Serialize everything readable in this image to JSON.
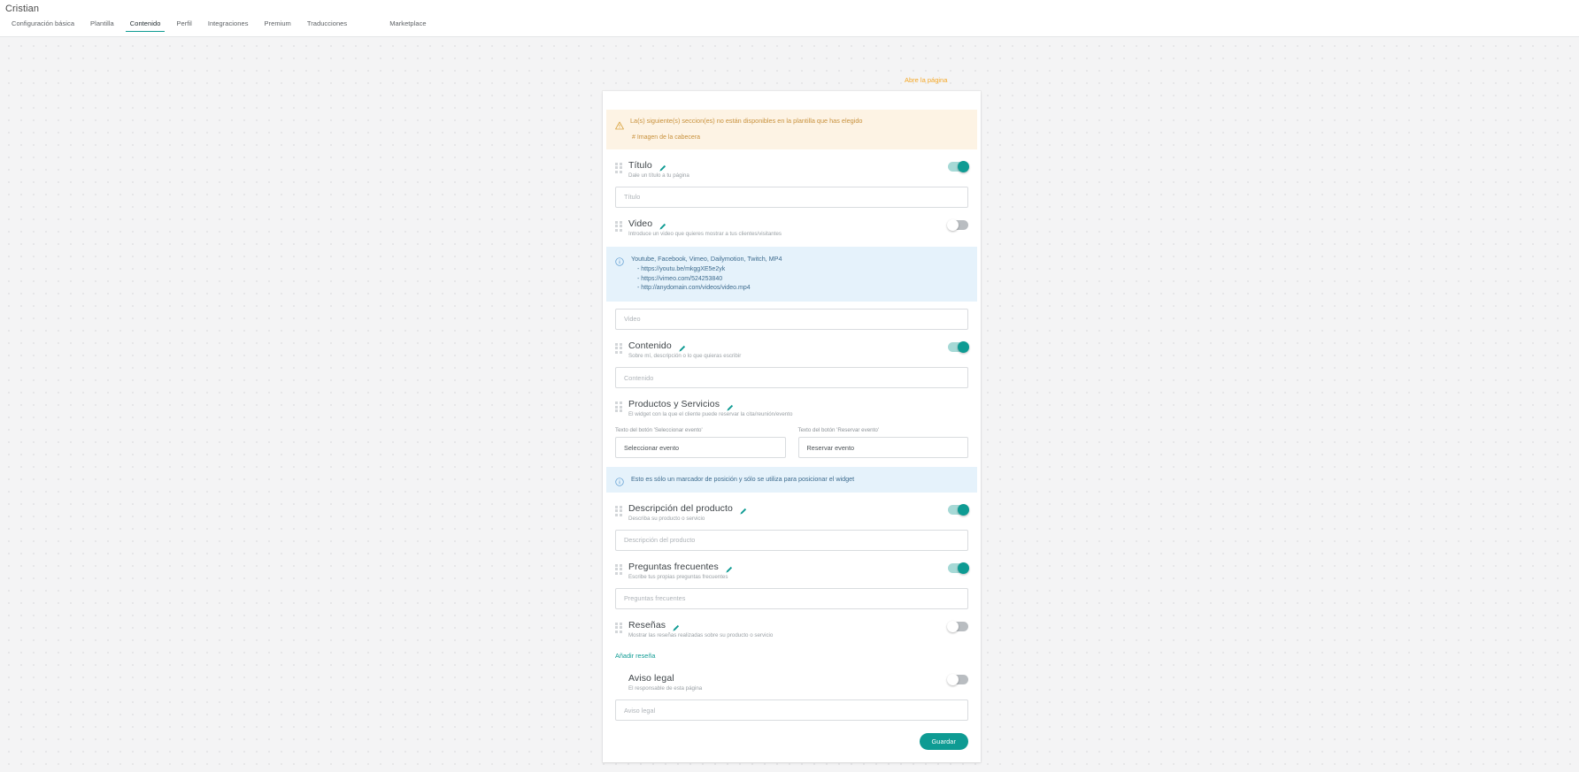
{
  "topbar": {
    "account_name": "Cristian",
    "tabs": [
      {
        "label": "Configuración básica",
        "active": false
      },
      {
        "label": "Plantilla",
        "active": false
      },
      {
        "label": "Contenido",
        "active": true
      },
      {
        "label": "Perfil",
        "active": false
      },
      {
        "label": "Integraciones",
        "active": false
      },
      {
        "label": "Premium",
        "active": false
      },
      {
        "label": "Traducciones",
        "active": false
      },
      {
        "label": "Marketplace",
        "active": false
      }
    ]
  },
  "canvas": {
    "open_page_link": "Abre la página"
  },
  "warning": {
    "icon": "warning-triangle-icon",
    "title": "La(s) siguiente(s) seccion(es) no están disponibles en la plantilla que has elegido",
    "items": [
      "# Imagen de la cabecera"
    ]
  },
  "sections": {
    "titulo": {
      "title": "Título",
      "subtitle": "Dale un título a tu página",
      "toggle_state": "on",
      "input_placeholder": "Título",
      "input_value": ""
    },
    "video": {
      "title": "Video",
      "subtitle": "Introduce un video que quieres mostrar a tus clientes/visitantes",
      "toggle_state": "off",
      "info_title": "Youtube, Facebook, Vimeo, Dailymotion, Twitch, MP4",
      "info_examples": [
        "- https://youtu.be/mkggXE5e2yk",
        "- https://vimeo.com/524253840",
        "- http://anydomain.com/videos/video.mp4"
      ],
      "input_placeholder": "Video",
      "input_value": ""
    },
    "contenido": {
      "title": "Contenido",
      "subtitle": "Sobre mí, descripción o lo que quieras escribir",
      "toggle_state": "on",
      "input_placeholder": "Contenido",
      "input_value": ""
    },
    "productos": {
      "title": "Productos y Servicios",
      "subtitle": "El widget con la que el cliente puede reservar la cita/reunión/evento",
      "button1_label": "Texto del botón 'Seleccionar evento'",
      "button1_value": "Seleccionar evento",
      "button2_label": "Texto del botón 'Reservar evento'",
      "button2_value": "Reservar evento",
      "info_text": "Esto es sólo un marcador de posición y sólo se utiliza para posicionar el widget"
    },
    "descripcion": {
      "title": "Descripción del producto",
      "subtitle": "Describa su producto o servicio",
      "toggle_state": "on",
      "input_placeholder": "Descripción del producto",
      "input_value": ""
    },
    "faq": {
      "title": "Preguntas frecuentes",
      "subtitle": "Escribe tus propias preguntas frecuentes",
      "toggle_state": "on",
      "input_placeholder": "Preguntas frecuentes",
      "input_value": ""
    },
    "resenas": {
      "title": "Reseñas",
      "subtitle": "Mostrar las reseñas realizadas sobre su producto o servicio",
      "toggle_state": "off",
      "add_link": "Añadir reseña"
    },
    "aviso": {
      "title": "Aviso legal",
      "subtitle": "El responsable de esta página",
      "toggle_state": "off",
      "input_placeholder": "Aviso legal",
      "input_value": ""
    }
  },
  "footer": {
    "save_label": "Guardar"
  },
  "colors": {
    "accent_teal": "#0e9b93",
    "warning_amber": "#c8913c",
    "warning_bg": "#fdf3e4",
    "info_blue": "#3d6b8e",
    "info_bg": "#e5f2fb",
    "link_orange": "#f5a623"
  }
}
